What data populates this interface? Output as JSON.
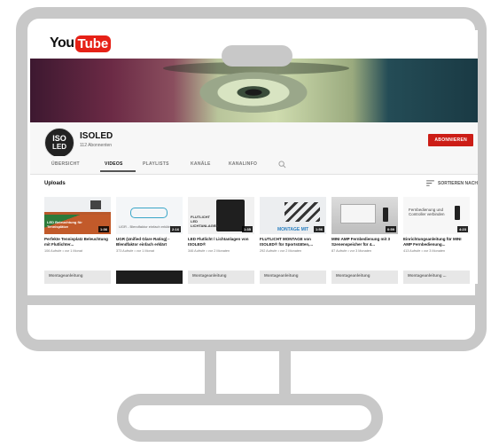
{
  "logo": {
    "you": "You",
    "tube": "Tube"
  },
  "channel": {
    "avatar_top": "ISO",
    "avatar_bottom": "LED",
    "name": "ISOLED",
    "subscribers": "112 Abonnenten",
    "subscribe_label": "ABONNIEREN"
  },
  "tabs": [
    "ÜBERSICHT",
    "VIDEOS",
    "PLAYLISTS",
    "KANÄLE",
    "KANALINFO"
  ],
  "active_tab": "VIDEOS",
  "uploads": {
    "title": "Uploads",
    "sort_label": "SORTIEREN NACH"
  },
  "videos": [
    {
      "title": "Perfekte Tennisplatz Beleuchtung mit Flutlichter...",
      "meta": "106 Aufrufe • vor 1 Monat",
      "duration": "1:36",
      "thumb_caption": "LED Beleuchtung für Tennisplätze"
    },
    {
      "title": "UGR (Unified Glare Rating) - Blendfaktor einfach erklärt",
      "meta": "373 Aufrufe • vor 1 Monat",
      "duration": "2:16",
      "thumb_caption": "UGR - Blendfaktor einfach erklärt"
    },
    {
      "title": "LED Flutlicht / Lichtanlagen von ISOLED®",
      "meta": "346 Aufrufe • vor 2 Monaten",
      "duration": "1:35",
      "thumb_caption": "FLUTLICHT LED LICHTANLAGEN"
    },
    {
      "title": "FLUTLICHT MONTAGE von ISOLED® für Sportstätten,...",
      "meta": "292 Aufrufe • vor 2 Monaten",
      "duration": "1:56",
      "thumb_caption": "MONTAGE MIT"
    },
    {
      "title": "MINI AMP Fernbedienung mit 3 Szenenspeicher für 4...",
      "meta": "87 Aufrufe • vor 3 Monaten",
      "duration": "0:59",
      "thumb_caption": ""
    },
    {
      "title": "Einrichtungsanleitung für MINI AMP Fernbedienung...",
      "meta": "413 Aufrufe • vor 3 Monaten",
      "duration": "4:23",
      "thumb_caption": "Fernbedienung und Controller verbinden"
    }
  ],
  "row2_labels": [
    "Montageanleitung",
    "",
    "Montageanleitung",
    "Montageanleitung",
    "Montageanleitung",
    "Montageanleitung ..."
  ],
  "colors": {
    "frame": "#c8c8c8",
    "subscribe": "#cc1d16",
    "yt_red": "#e62117"
  }
}
